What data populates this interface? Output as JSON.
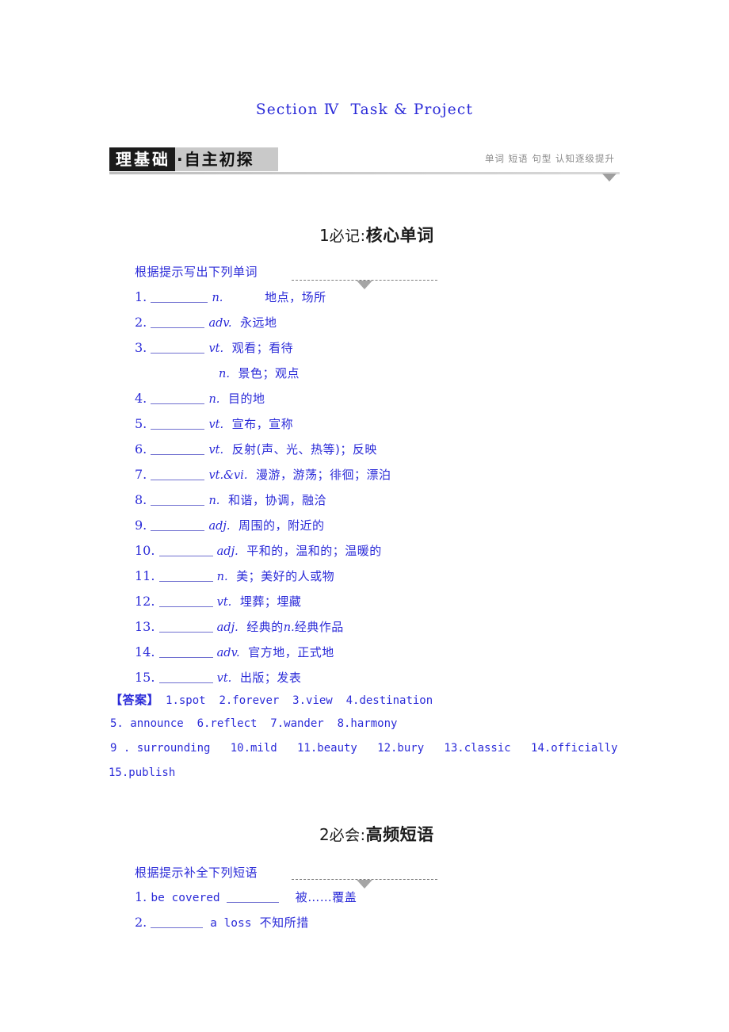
{
  "page_title": "Section Ⅳ  Task & Project",
  "banner": {
    "dark_text": "理基础",
    "light_text": "·自主初探",
    "right_text": "单词 短语 句型 认知逐级提升"
  },
  "sections": [
    {
      "number": "1",
      "label": "必记:",
      "title": "核心单词",
      "prompt": "根据提示写出下列单词",
      "entries": [
        {
          "num": "1.",
          "pos": "n.",
          "gap": "          ",
          "def": "地点，场所"
        },
        {
          "num": "2.",
          "pos": "adv.",
          "gap": "  ",
          "def": "永远地"
        },
        {
          "num": "3.",
          "pos": "vt.",
          "gap": "  ",
          "def": "观看；看待"
        },
        {
          "num": "",
          "pos": "n.",
          "gap": "  ",
          "def": "景色；观点",
          "continuation": true
        },
        {
          "num": "4.",
          "pos": "n.",
          "gap": "  ",
          "def": "目的地"
        },
        {
          "num": "5.",
          "pos": "vt.",
          "gap": "  ",
          "def": "宣布，宣称"
        },
        {
          "num": "6.",
          "pos": "vt.",
          "gap": "  ",
          "def": "反射(声、光、热等)；反映"
        },
        {
          "num": "7.",
          "pos": "vt.&vi.",
          "gap": "  ",
          "def": "漫游，游荡；徘徊；漂泊"
        },
        {
          "num": "8.",
          "pos": "n.",
          "gap": "  ",
          "def": "和谐，协调，融洽"
        },
        {
          "num": "9.",
          "pos": "adj.",
          "gap": "  ",
          "def": "周围的，附近的"
        },
        {
          "num": "10.",
          "pos": "adj.",
          "gap": "  ",
          "def": "平和的，温和的；温暖的"
        },
        {
          "num": "11.",
          "pos": "n.",
          "gap": "  ",
          "def": "美；美好的人或物"
        },
        {
          "num": "12.",
          "pos": "vt.",
          "gap": "  ",
          "def": "埋葬；埋藏"
        },
        {
          "num": "13.",
          "pos": "adj.",
          "gap": "  ",
          "def": "经典的",
          "def_pos2": "n.",
          "def2": "经典作品"
        },
        {
          "num": "14.",
          "pos": "adv.",
          "gap": "  ",
          "def": "官方地，正式地"
        },
        {
          "num": "15.",
          "pos": "vt.",
          "gap": "  ",
          "def": "出版；发表"
        }
      ],
      "answer_label": "【答案】",
      "answer_lines": [
        "1.spot  2.forever  3.view  4.destination",
        "5. announce  6.reflect  7.wander  8.harmony",
        "9 . surrounding   10.mild   11.beauty   12.bury   13.classic   14.officially",
        "15.publish"
      ]
    },
    {
      "number": "2",
      "label": "必会:",
      "title": "高频短语",
      "prompt": "根据提示补全下列短语",
      "phrases": [
        {
          "num": "1.",
          "before": "be covered ",
          "after": "",
          "def": "被……覆盖"
        },
        {
          "num": "2.",
          "before": "",
          "after": " a loss",
          "def": "不知所措"
        }
      ]
    }
  ],
  "colors": {
    "text_blue": "#2b2bd8",
    "banner_dark": "#1b1b1b",
    "banner_light": "#c9c9c9",
    "rule_gray": "#a5a5a5"
  }
}
